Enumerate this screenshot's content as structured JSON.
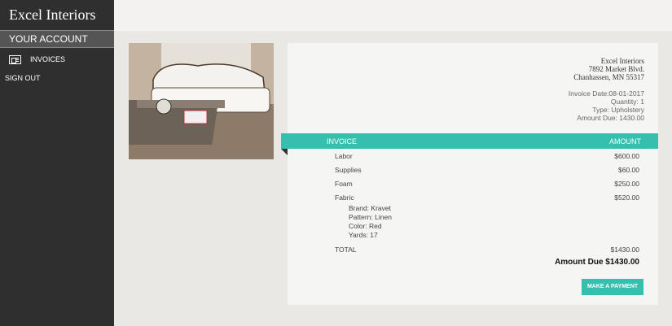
{
  "sidebar": {
    "brand": "Excel Interiors",
    "account_label": "Your Account",
    "items": [
      {
        "label": "Invoices",
        "icon": "invoice-icon"
      }
    ],
    "signout_label": "Sign Out"
  },
  "company": {
    "name": "Excel Interiors",
    "address_line1": "7892 Market Blvd.",
    "address_line2": "Chanhassen, MN 55317"
  },
  "invoice_meta": {
    "date": "Invoice Date:08-01-2017",
    "quantity": "Quantity: 1",
    "type": "Type: Upholstery",
    "amount_due": "Amount Due: 1430.00"
  },
  "table": {
    "col_invoice": "Invoice",
    "col_amount": "Amount",
    "rows": [
      {
        "desc": "Labor",
        "amount": "$600.00"
      },
      {
        "desc": "Supplies",
        "amount": "$60.00"
      },
      {
        "desc": "Foam",
        "amount": "$250.00"
      },
      {
        "desc": "Fabric",
        "amount": "$520.00"
      }
    ],
    "fabric_details": [
      "Brand: Kravet",
      "Pattern: Linen",
      "Color: Red",
      "Yards: 17"
    ],
    "total_label": "TOTAL",
    "total_amount": "$1430.00",
    "amount_due_label": "Amount Due $1430.00"
  },
  "actions": {
    "pay_label": "Make a Payment"
  },
  "colors": {
    "accent": "#35bfae",
    "sidebar": "#2f2f2f"
  }
}
